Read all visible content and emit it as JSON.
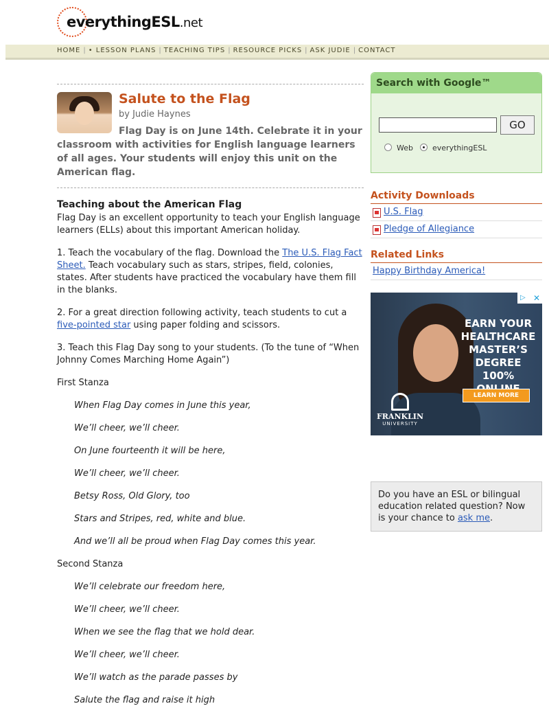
{
  "header": {
    "logo_main": "everythingESL",
    "logo_suffix": ".net"
  },
  "nav": {
    "items": [
      "HOME",
      "• LESSON PLANS",
      "TEACHING TIPS",
      "RESOURCE PICKS",
      "ASK JUDIE",
      "CONTACT"
    ],
    "separator": "|"
  },
  "article": {
    "title": "Salute to the Flag",
    "byline": "by Judie Haynes",
    "lede": "Flag Day is on June 14th. Celebrate it in your classroom with activities for English language learners of all ages. Your students will enjoy this unit on the American flag.",
    "section_heading": "Teaching about the American Flag",
    "intro": "Flag Day is an excellent opportunity to teach your English language learners (ELLs) about this important American holiday.",
    "step1_a": "1. Teach the vocabulary of the flag. Download the ",
    "step1_link": "The U.S. Flag Fact Sheet.",
    "step1_b": " Teach vocabulary such as stars, stripes, field, colonies, states. After students have practiced the vocabulary have them fill in the blanks.",
    "step2_a": "2. For a great direction following activity, teach students to cut a ",
    "step2_link": "five-pointed star",
    "step2_b": " using paper folding and scissors.",
    "step3": "3. Teach this Flag Day song to your students. (To the tune of “When Johnny Comes Marching Home Again”)",
    "stanza1_label": "First Stanza",
    "stanza1": [
      "When Flag Day comes in June this year,",
      "We’ll cheer, we’ll cheer.",
      "On June fourteenth it will be here,",
      "We’ll cheer, we’ll cheer.",
      "Betsy Ross, Old Glory, too",
      "Stars and Stripes, red, white and blue.",
      "And we’ll all be proud when Flag Day comes this year."
    ],
    "stanza2_label": "Second Stanza",
    "stanza2": [
      "We’ll celebrate our freedom here,",
      "We’ll cheer, we’ll cheer.",
      "When we see the flag that we hold dear.",
      "We’ll cheer, we’ll cheer.",
      "We’ll watch as the parade passes by",
      "Salute the flag and raise it high"
    ]
  },
  "sidebar": {
    "search_title": "Search with Google™",
    "search_value": "",
    "go_label": "GO",
    "radio_web": "Web",
    "radio_site": "everythingESL",
    "downloads_heading": "Activity Downloads",
    "downloads": [
      "U.S. Flag",
      "Pledge of Allegiance"
    ],
    "links_heading": "Related Links",
    "links": [
      "Happy Birthday America!"
    ],
    "ad": {
      "lines": [
        "EARN YOUR",
        "HEALTHCARE",
        "MASTER’S",
        "DEGREE",
        "100% ONLINE"
      ],
      "cta": "LEARN MORE",
      "brand": "FRANKLIN",
      "brand_sub": "UNIVERSITY"
    },
    "judie_text": "Do you have an ESL or bilingual education related question? Now is your chance to ",
    "judie_link": "ask me",
    "judie_end": "."
  }
}
